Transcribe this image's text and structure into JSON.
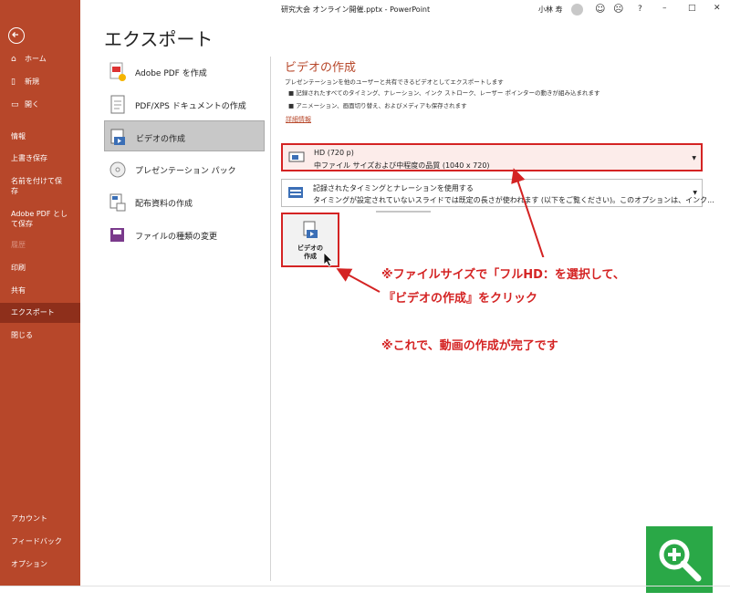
{
  "window": {
    "title": "研究大会 オンライン開催.pptx - PowerPoint",
    "user": "小林 寿",
    "controls": {
      "help": "?",
      "minimize": "–",
      "maximize": "□",
      "close": "✕"
    }
  },
  "sidebar": {
    "items": [
      {
        "label": "ホーム",
        "icon": "home-icon"
      },
      {
        "label": "新規",
        "icon": "new-document-icon"
      },
      {
        "label": "開く",
        "icon": "folder-open-icon"
      },
      {
        "label": "情報"
      },
      {
        "label": "上書き保存"
      },
      {
        "label_1": "名前を付けて保",
        "label_2": "存"
      },
      {
        "label_1": "Adobe PDF とし",
        "label_2": "て保存"
      },
      {
        "label": "履歴"
      },
      {
        "label": "印刷"
      },
      {
        "label": "共有"
      },
      {
        "label": "エクスポート"
      },
      {
        "label": "閉じる"
      }
    ],
    "bottom": [
      {
        "label": "アカウント"
      },
      {
        "label": "フィードバック"
      },
      {
        "label": "オプション"
      }
    ]
  },
  "main": {
    "title": "エクスポート",
    "options": [
      {
        "label": "Adobe PDF を作成",
        "icon": "adobe-pdf-icon"
      },
      {
        "label": "PDF/XPS ドキュメントの作成",
        "icon": "pdf-xps-icon"
      },
      {
        "label": "ビデオの作成",
        "icon": "video-icon"
      },
      {
        "label": "プレゼンテーション パック",
        "icon": "cd-package-icon"
      },
      {
        "label": "配布資料の作成",
        "icon": "handout-icon"
      },
      {
        "label": "ファイルの種類の変更",
        "icon": "file-type-icon"
      }
    ]
  },
  "detail": {
    "title": "ビデオの作成",
    "desc": "プレゼンテーションを他のユーザーと共有できるビデオとしてエクスポートします",
    "bullets": [
      "記録されたすべてのタイミング、ナレーション、インク ストローク、レーザー ポインターの動きが組み込まれます",
      "アニメーション、画面切り替え、およびメディアも保存されます"
    ],
    "link": "詳細情報",
    "quality": {
      "line1": "HD (720 p)",
      "line2": "中ファイル サイズおよび中程度の品質 (1040 x 720)"
    },
    "timing": {
      "line1": "記録されたタイミングとナレーションを使用する",
      "line2": "タイミングが設定されていないスライドでは既定の長さが使われます (以下をご覧ください)。このオプションは、インク..."
    },
    "create_button": {
      "line1": "ビデオの",
      "line2": "作成"
    }
  },
  "annotation": {
    "line1": "※ファイルサイズで「フルHD：を選択して、",
    "line2": "『ビデオの作成』をクリック",
    "line3": "※これで、動画の作成が完了です"
  },
  "colors": {
    "accent": "#b7472a",
    "highlight": "#d42323",
    "zoom": "#2aa847"
  }
}
